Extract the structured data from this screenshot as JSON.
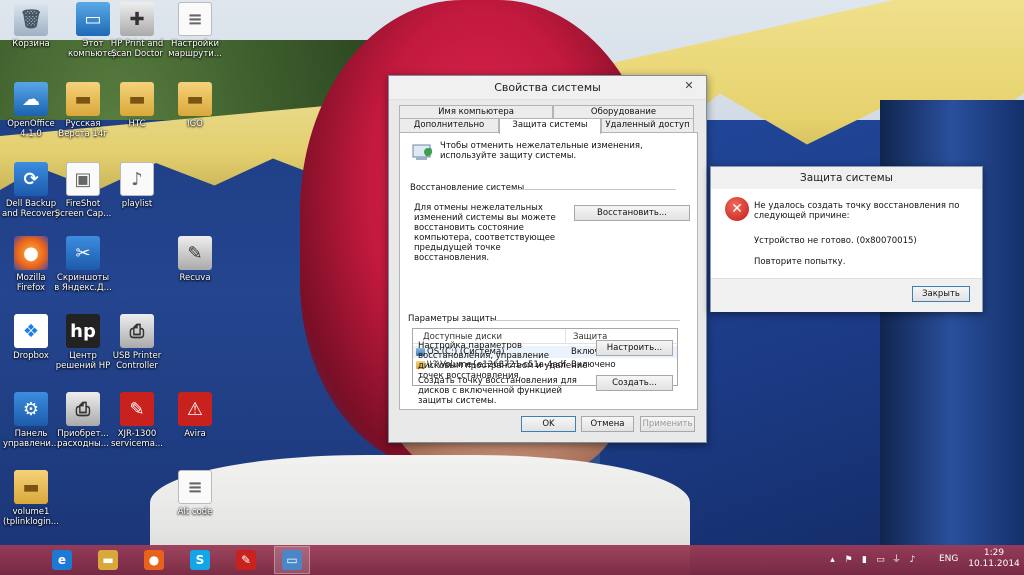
{
  "desktop_icons": [
    {
      "label": "Корзина",
      "icon": "recycle-bin-icon",
      "glyph": "🗑"
    },
    {
      "label": "Этот\nкомпьютер",
      "icon": "computer-icon",
      "glyph": "▭"
    },
    {
      "label": "HP Print and\nScan Doctor",
      "icon": "hp-print-scan-icon",
      "glyph": "✚"
    },
    {
      "label": "Настройки\nмаршрути...",
      "icon": "document-icon",
      "glyph": "≡"
    },
    {
      "label": "OpenOffice\n4.1.0",
      "icon": "openoffice-icon",
      "glyph": "☁"
    },
    {
      "label": "Русская\nВерста 14г",
      "icon": "folder-icon",
      "glyph": "▬"
    },
    {
      "label": "HTC",
      "icon": "folder-icon",
      "glyph": "▬"
    },
    {
      "label": "IGO",
      "icon": "folder-icon",
      "glyph": "▬"
    },
    {
      "label": "Dell Backup\nand Recovery",
      "icon": "dell-backup-icon",
      "glyph": "⟳"
    },
    {
      "label": "FireShot\nScreen Cap...",
      "icon": "fireshot-icon",
      "glyph": "▣"
    },
    {
      "label": "playlist",
      "icon": "music-file-icon",
      "glyph": "♪"
    },
    {
      "label": "Mozilla\nFirefox",
      "icon": "firefox-icon",
      "glyph": "●"
    },
    {
      "label": "Скриншоты\nв Яндекс.Д...",
      "icon": "yandex-screenshot-icon",
      "glyph": "✂"
    },
    {
      "label": "Recuva",
      "icon": "recuva-icon",
      "glyph": "✎"
    },
    {
      "label": "Dropbox",
      "icon": "dropbox-icon",
      "glyph": "❖"
    },
    {
      "label": "Центр\nрешений HP",
      "icon": "hp-icon",
      "glyph": "hp"
    },
    {
      "label": "USB Printer\nController",
      "icon": "printer-icon",
      "glyph": "⎙"
    },
    {
      "label": "Панель\nуправлени...",
      "icon": "control-panel-icon",
      "glyph": "⚙"
    },
    {
      "label": "Приобрет...\nрасходны...",
      "icon": "printer-supplies-icon",
      "glyph": "⎙"
    },
    {
      "label": "XJR-1300\nservicema...",
      "icon": "pdf-icon",
      "glyph": "✎"
    },
    {
      "label": "Avira",
      "icon": "avira-icon",
      "glyph": "⚠"
    },
    {
      "label": "volume1\n(tplinklogin...",
      "icon": "folder-icon",
      "glyph": "▬"
    },
    {
      "label": "Alt code",
      "icon": "document-icon",
      "glyph": "≡"
    }
  ],
  "sysprops": {
    "title": "Свойства системы",
    "close": "✕",
    "tabs_top": [
      "Имя компьютера",
      "Оборудование"
    ],
    "tabs_bottom": [
      "Дополнительно",
      "Защита системы",
      "Удаленный доступ"
    ],
    "intro": "Чтобы отменить нежелательные изменения, используйте защиту системы.",
    "restore_section": "Восстановление системы",
    "restore_text": "Для отмены нежелательных изменений системы вы можете восстановить состояние компьютера, соответствующее предыдущей точке восстановления.",
    "restore_button": "Восстановить...",
    "protection_section": "Параметры защиты",
    "columns": [
      "Доступные диски",
      "Защита"
    ],
    "drives": [
      {
        "name": "OS (C:) (Система)",
        "status": "Включено",
        "icon": "drive-icon"
      },
      {
        "name": "\\\\?\\Volume{e1268721-c51a-4adf-a...",
        "status": "Включено",
        "icon": "folder-icon"
      }
    ],
    "config_text": "Настройка параметров восстановления, управление дисковым пространством и удаление точек восстановления.",
    "config_button": "Настроить...",
    "create_text": "Создать точку восстановления для дисков с включенной функцией защиты системы.",
    "create_button": "Создать...",
    "ok": "OK",
    "cancel": "Отмена",
    "apply": "Применить"
  },
  "error_dialog": {
    "title": "Защита системы",
    "message": "Не удалось создать точку восстановления по следующей причине:",
    "detail": "Устройство не готово. (0x80070015)",
    "retry": "Повторите попытку.",
    "close_button": "Закрыть"
  },
  "taskbar": {
    "apps": [
      {
        "name": "internet-explorer",
        "glyph": "e"
      },
      {
        "name": "file-explorer",
        "glyph": "▬"
      },
      {
        "name": "firefox",
        "glyph": "●"
      },
      {
        "name": "skype",
        "glyph": "S"
      },
      {
        "name": "pdf-reader",
        "glyph": "✎"
      },
      {
        "name": "system-properties",
        "glyph": "▭"
      }
    ],
    "language": "ENG",
    "time": "1:29",
    "date": "10.11.2014"
  },
  "colors": {
    "taskbar": "#8e3556",
    "error_red": "#c51c14",
    "accent_border": "#3c7fb1"
  }
}
